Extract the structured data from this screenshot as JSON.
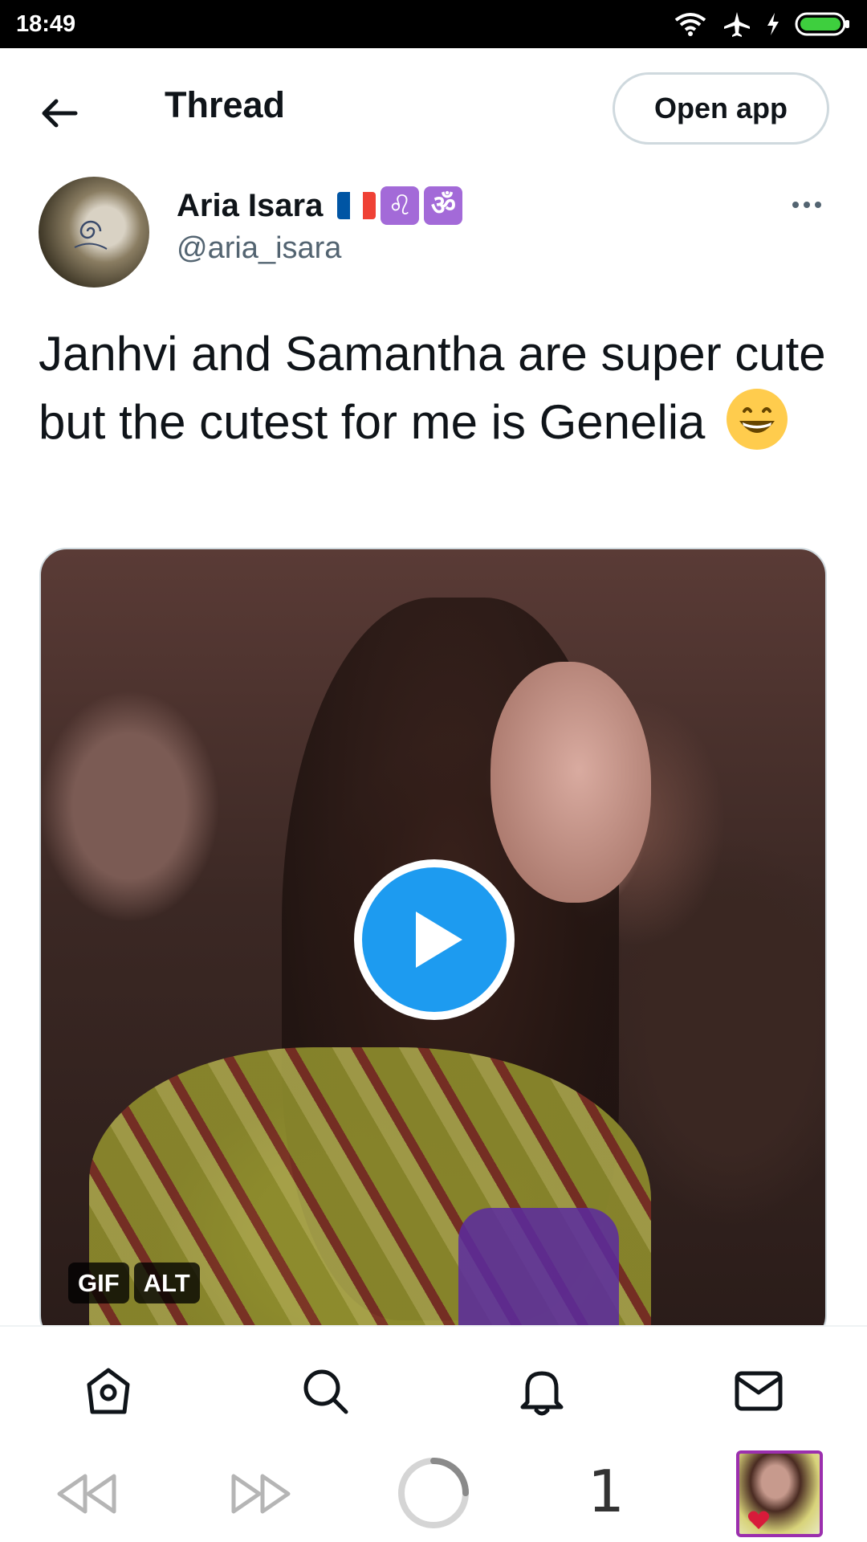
{
  "status_bar": {
    "time": "18:49"
  },
  "header": {
    "title": "Thread",
    "open_app_label": "Open app"
  },
  "tweet": {
    "author_name": "Aria Isara",
    "handle": "@aria_isara",
    "name_emojis": [
      "french-flag",
      "leo-zodiac",
      "om-symbol"
    ],
    "zodiac_glyph": "♌",
    "om_glyph": "ॐ",
    "text": "Janhvi and Samantha are super cute but the cutest for me is Genelia",
    "media": {
      "type": "GIF",
      "badges": [
        "GIF",
        "ALT"
      ]
    }
  },
  "bottom_nav": {
    "items": [
      "home",
      "search",
      "notifications",
      "messages"
    ]
  },
  "browser_bar": {
    "tab_count": "1"
  },
  "colors": {
    "accent": "#1d9bf0",
    "text": "#0f1419",
    "secondary": "#536471",
    "border": "#cfd9de"
  }
}
